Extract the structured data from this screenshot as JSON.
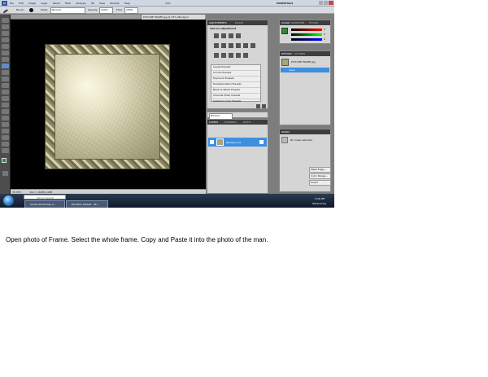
{
  "app": {
    "logo": "Ps",
    "workspace": "ESSENTIALS",
    "menus": [
      "File",
      "Edit",
      "Image",
      "Layer",
      "Select",
      "Filter",
      "Analysis",
      "3D",
      "View",
      "Window",
      "Help"
    ],
    "zoom": "33%"
  },
  "options_bar": {
    "brush_label": "Brush:",
    "mode_label": "Mode:",
    "mode_value": "Normal",
    "opacity_label": "Opacity:",
    "opacity_value": "100%",
    "flow_label": "Flow:",
    "flow_value": "100%"
  },
  "document": {
    "tab_title": "PICTURE FRAME.jpg @ 33% (Backgrd",
    "status_zoom": "33.33%",
    "status_doc": "Doc: 1.40M/1.40M"
  },
  "adjustments": {
    "tabs": [
      "ADJUSTMENTS",
      "MASKS"
    ],
    "title": "Add an adjustment",
    "presets": [
      "Levels Presets",
      "Curves Presets",
      "Exposure Presets",
      "Hue/Saturation Presets",
      "Black & White Presets",
      "Channel Mixer Presets",
      "Selective Color Presets"
    ]
  },
  "layers": {
    "tabs": [
      "LAYERS",
      "CHANNELS",
      "PATHS"
    ],
    "blend_mode": "Normal",
    "layer_name": "Background"
  },
  "color_panel": {
    "tabs": [
      "COLOR",
      "SWATCHES",
      "STYLES"
    ],
    "values": [
      "0",
      "0",
      "0"
    ]
  },
  "history": {
    "tabs": [
      "HISTORY",
      "ACTIONS"
    ],
    "snapshot": "PICTURE FRAME.jpg",
    "state": "Open"
  },
  "masks": {
    "tabs": [
      "MASKS"
    ],
    "message": "No mask selected",
    "buttons": [
      "Mask Edge...",
      "Color Range...",
      "Invert"
    ]
  },
  "taskbar": {
    "search_placeholder": "Yahoo! Search",
    "items": [
      "Adobe Photoshop C...",
      "Eat Mine Stealer - Mi..."
    ],
    "time": "4:46 PM",
    "day": "Wednesday"
  },
  "caption": "Open photo of Frame. Select the whole frame. Copy and Paste it into the photo of the man."
}
